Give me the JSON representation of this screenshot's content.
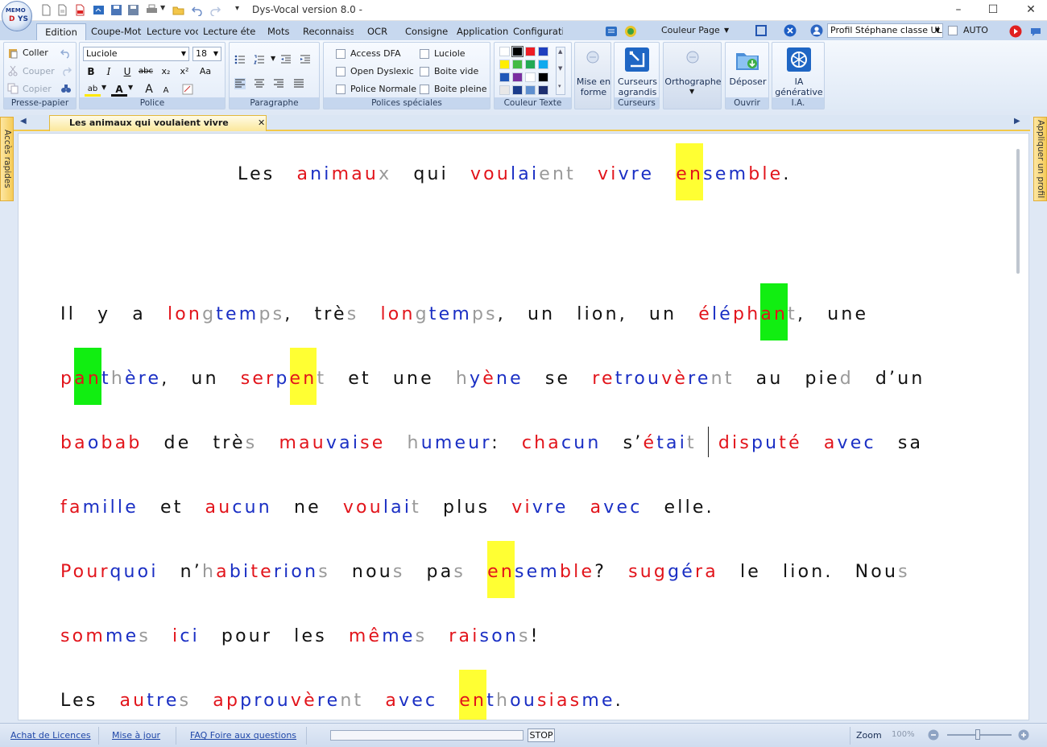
{
  "app": {
    "title": "Dys-Vocal version 8.0",
    "title_suffix": "-",
    "logo_lines": [
      "MEMO",
      "D",
      "YS"
    ]
  },
  "menu_tabs": [
    "Edition",
    "Coupe-Mot",
    "Lecture voca",
    "Lecture éten",
    "Mots",
    "Reconnaiss",
    "OCR",
    "Consigne",
    "Applications",
    "Configuratio"
  ],
  "ribbon_top": {
    "couleur_page": "Couleur Page",
    "profile": "Profil Stéphane classe UL",
    "auto": "AUTO"
  },
  "groups": {
    "presse_papier": {
      "label": "Presse-papier",
      "coller": "Coller",
      "couper": "Couper",
      "copier": "Copier"
    },
    "police": {
      "label": "Police",
      "font": "Luciole",
      "size": "18",
      "bold": "B",
      "italic": "I",
      "underline": "U",
      "strike": "abc",
      "sub": "x₂",
      "sup": "x²",
      "case": "Aa",
      "highlight": "ab",
      "color": "A",
      "grow": "A",
      "shrink": "A"
    },
    "paragraphe": {
      "label": "Paragraphe"
    },
    "polices_speciales": {
      "label": "Polices spéciales",
      "options": [
        "Access DFA",
        "Open Dyslexic",
        "Police Normale",
        "Luciole",
        "Boite vide",
        "Boite pleine"
      ]
    },
    "couleur_texte": {
      "label": "Couleur Texte",
      "swatches": [
        "#ffffff",
        "#000000",
        "#ee1c24",
        "#1f3fbf",
        "#ffee00",
        "#44bb44",
        "#22aa55",
        "#11aaee",
        "#1f57b8",
        "#7a2fa0",
        "#ffffff",
        "#000000",
        "#e8e8e8",
        "#1c3d8c",
        "#5f8fcf",
        "#1e2f70"
      ]
    },
    "mise_en_forme": {
      "label": "Mise en forme"
    },
    "curseurs": {
      "label": "Curseurs",
      "button": "Curseurs agrandis"
    },
    "orthographe": {
      "label": "Orthographe"
    },
    "ouvrir": {
      "label": "Ouvrir",
      "button": "Déposer"
    },
    "ia": {
      "label": "I.A.",
      "button": "IA générative"
    }
  },
  "document": {
    "tab_title": "Les animaux qui voulaient vivre ensemble",
    "side_left": "Accès rapides",
    "side_right": "Appliquer un profil"
  },
  "text_lines": [
    {
      "words": [
        [
          [
            "Les",
            "k"
          ]
        ],
        [
          [
            "a",
            "r"
          ],
          [
            "ni",
            "b"
          ],
          [
            "mau",
            "r"
          ],
          [
            "x",
            "g"
          ]
        ],
        [
          [
            "qui",
            "k"
          ]
        ],
        [
          [
            "vou",
            "r"
          ],
          [
            "lai",
            "b"
          ],
          [
            "ent",
            "g"
          ]
        ],
        [
          [
            "vi",
            "r"
          ],
          [
            "vre",
            "b"
          ]
        ],
        [
          [
            "en",
            "r",
            "hy"
          ],
          [
            "sem",
            "b"
          ],
          [
            "ble",
            "r"
          ],
          [
            ".",
            "k"
          ]
        ]
      ]
    },
    {
      "words": [
        [
          [
            "Il",
            "k"
          ]
        ],
        [
          [
            "y",
            "k"
          ]
        ],
        [
          [
            "a",
            "k"
          ]
        ],
        [
          [
            "lon",
            "r"
          ],
          [
            "g",
            "g"
          ],
          [
            "tem",
            "b"
          ],
          [
            "ps",
            "g"
          ],
          [
            ",",
            "k"
          ]
        ],
        [
          [
            "trè",
            "k"
          ],
          [
            "s",
            "g"
          ]
        ],
        [
          [
            "lon",
            "r"
          ],
          [
            "g",
            "g"
          ],
          [
            "tem",
            "b"
          ],
          [
            "ps",
            "g"
          ],
          [
            ",",
            "k"
          ]
        ],
        [
          [
            "un",
            "k"
          ]
        ],
        [
          [
            "lion,",
            "k"
          ]
        ],
        [
          [
            "un",
            "k"
          ]
        ],
        [
          [
            "é",
            "r"
          ],
          [
            "lé",
            "b"
          ],
          [
            "ph",
            "r"
          ],
          [
            "an",
            "r",
            "hg"
          ],
          [
            "t",
            "g"
          ],
          [
            ",",
            "k"
          ]
        ],
        [
          [
            "une",
            "k"
          ]
        ]
      ]
    },
    {
      "words": [
        [
          [
            "p",
            "r"
          ],
          [
            "an",
            "r",
            "hg"
          ],
          [
            "t",
            "b"
          ],
          [
            "h",
            "g"
          ],
          [
            "ère",
            "b"
          ],
          [
            ",",
            "k"
          ]
        ],
        [
          [
            "un",
            "k"
          ]
        ],
        [
          [
            "ser",
            "r"
          ],
          [
            "p",
            "b"
          ],
          [
            "en",
            "r",
            "hy"
          ],
          [
            "t",
            "g"
          ]
        ],
        [
          [
            "et",
            "k"
          ]
        ],
        [
          [
            "une",
            "k"
          ]
        ],
        [
          [
            "h",
            "g"
          ],
          [
            "y",
            "b"
          ],
          [
            "è",
            "r"
          ],
          [
            "ne",
            "b"
          ]
        ],
        [
          [
            "se",
            "k"
          ]
        ],
        [
          [
            "re",
            "r"
          ],
          [
            "trou",
            "b"
          ],
          [
            "vè",
            "r"
          ],
          [
            "re",
            "b"
          ],
          [
            "nt",
            "g"
          ]
        ],
        [
          [
            "au",
            "k"
          ]
        ],
        [
          [
            "pie",
            "k"
          ],
          [
            "d",
            "g"
          ]
        ],
        [
          [
            "d’un",
            "k"
          ]
        ]
      ]
    },
    {
      "words": [
        [
          [
            "ba",
            "r"
          ],
          [
            "o",
            "b"
          ],
          [
            "bab",
            "r"
          ]
        ],
        [
          [
            "de",
            "k"
          ]
        ],
        [
          [
            "trè",
            "k"
          ],
          [
            "s",
            "g"
          ]
        ],
        [
          [
            "mau",
            "r"
          ],
          [
            "vai",
            "b"
          ],
          [
            "se",
            "r"
          ]
        ],
        [
          [
            "h",
            "g"
          ],
          [
            "u",
            "b"
          ],
          [
            "meur",
            "b"
          ],
          [
            ":",
            "k"
          ]
        ],
        [
          [
            "cha",
            "r"
          ],
          [
            "cun",
            "b"
          ]
        ],
        [
          [
            "s’",
            "k"
          ],
          [
            "é",
            "r"
          ],
          [
            "tai",
            "b"
          ],
          [
            "t",
            "g"
          ]
        ],
        [
          [
            "dis",
            "r"
          ],
          [
            "pu",
            "b"
          ],
          [
            "té",
            "r"
          ]
        ],
        [
          [
            "a",
            "r"
          ],
          [
            "vec",
            "b"
          ]
        ],
        [
          [
            "sa",
            "k"
          ]
        ]
      ]
    },
    {
      "words": [
        [
          [
            "fa",
            "r"
          ],
          [
            "mille",
            "b"
          ]
        ],
        [
          [
            "et",
            "k"
          ]
        ],
        [
          [
            "au",
            "r"
          ],
          [
            "cun",
            "b"
          ]
        ],
        [
          [
            "ne",
            "k"
          ]
        ],
        [
          [
            "vou",
            "r"
          ],
          [
            "lai",
            "b"
          ],
          [
            "t",
            "g"
          ]
        ],
        [
          [
            "plus",
            "k"
          ]
        ],
        [
          [
            "vi",
            "r"
          ],
          [
            "vre",
            "b"
          ]
        ],
        [
          [
            "a",
            "r"
          ],
          [
            "vec",
            "b"
          ]
        ],
        [
          [
            "elle.",
            "k"
          ]
        ]
      ]
    },
    {
      "words": [
        [
          [
            "Pour",
            "r"
          ],
          [
            "quoi",
            "b"
          ]
        ],
        [
          [
            "n’",
            "k"
          ],
          [
            "h",
            "g"
          ],
          [
            "a",
            "r"
          ],
          [
            "bi",
            "b"
          ],
          [
            "te",
            "r"
          ],
          [
            "rion",
            "b"
          ],
          [
            "s",
            "g"
          ]
        ],
        [
          [
            "nou",
            "k"
          ],
          [
            "s",
            "g"
          ]
        ],
        [
          [
            "pa",
            "k"
          ],
          [
            "s",
            "g"
          ]
        ],
        [
          [
            "en",
            "r",
            "hy"
          ],
          [
            "sem",
            "b"
          ],
          [
            "ble",
            "r"
          ],
          [
            "?",
            "k"
          ]
        ],
        [
          [
            "sug",
            "r"
          ],
          [
            "gé",
            "b"
          ],
          [
            "ra",
            "r"
          ]
        ],
        [
          [
            "le",
            "k"
          ]
        ],
        [
          [
            "lion.",
            "k"
          ]
        ],
        [
          [
            "Nou",
            "k"
          ],
          [
            "s",
            "g"
          ]
        ]
      ]
    },
    {
      "words": [
        [
          [
            "som",
            "r"
          ],
          [
            "me",
            "b"
          ],
          [
            "s",
            "g"
          ]
        ],
        [
          [
            "i",
            "r"
          ],
          [
            "ci",
            "b"
          ]
        ],
        [
          [
            "pour",
            "k"
          ]
        ],
        [
          [
            "les",
            "k"
          ]
        ],
        [
          [
            "mê",
            "r"
          ],
          [
            "me",
            "b"
          ],
          [
            "s",
            "g"
          ]
        ],
        [
          [
            "rai",
            "r"
          ],
          [
            "son",
            "b"
          ],
          [
            "s",
            "g"
          ],
          [
            "!",
            "k"
          ]
        ]
      ]
    },
    {
      "words": [
        [
          [
            "Les",
            "k"
          ]
        ],
        [
          [
            "au",
            "r"
          ],
          [
            "tre",
            "b"
          ],
          [
            "s",
            "g"
          ]
        ],
        [
          [
            "ap",
            "r"
          ],
          [
            "prou",
            "b"
          ],
          [
            "vè",
            "r"
          ],
          [
            "re",
            "b"
          ],
          [
            "nt",
            "g"
          ]
        ],
        [
          [
            "a",
            "r"
          ],
          [
            "vec",
            "b"
          ]
        ],
        [
          [
            "en",
            "r",
            "hy"
          ],
          [
            "t",
            "b"
          ],
          [
            "h",
            "g"
          ],
          [
            "ou",
            "b"
          ],
          [
            "sias",
            "r"
          ],
          [
            "me",
            "b"
          ],
          [
            ".",
            "k"
          ]
        ]
      ]
    }
  ],
  "status": {
    "links": [
      "Achat de Licences",
      "Mise à jour",
      "FAQ Foire aux questions"
    ],
    "stop": "STOP",
    "zoom_label": "Zoom",
    "zoom_value": "100%"
  }
}
